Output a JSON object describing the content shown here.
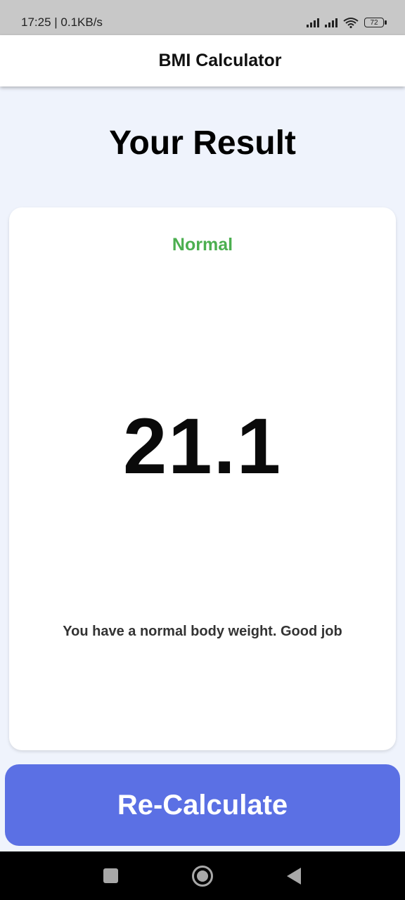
{
  "status_bar": {
    "time_speed": "17:25 | 0.1KB/s",
    "battery": "72"
  },
  "app_bar": {
    "title": "BMI Calculator"
  },
  "main": {
    "heading": "Your Result",
    "result": {
      "category": "Normal",
      "category_color": "#4caf50",
      "bmi": "21.1",
      "message": "You have a normal body weight. Good job"
    },
    "recalculate_label": "Re-Calculate",
    "button_color": "#5b70e4"
  },
  "navigation": {
    "icons": [
      "recents-icon",
      "home-icon",
      "back-icon"
    ]
  }
}
